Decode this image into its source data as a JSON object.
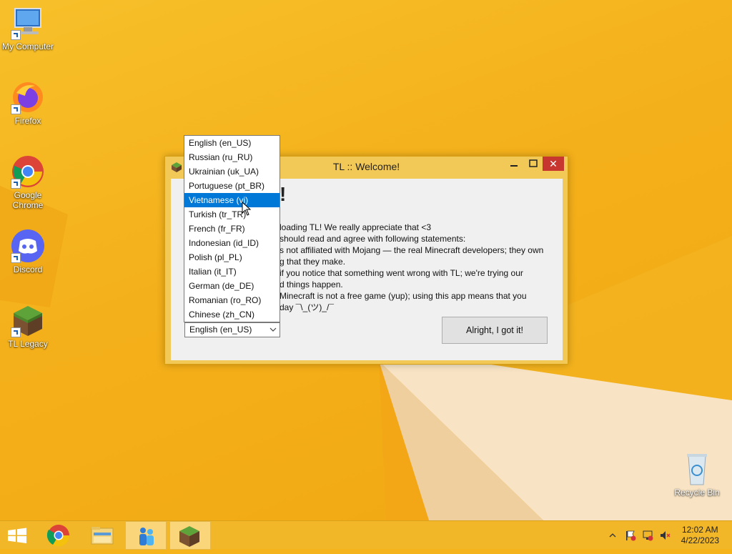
{
  "desktop": {
    "icons": [
      {
        "label": "My Computer",
        "icon": "computer-icon"
      },
      {
        "label": "Firefox",
        "icon": "firefox-icon"
      },
      {
        "label": "Google Chrome",
        "icon": "chrome-icon"
      },
      {
        "label": "Discord",
        "icon": "discord-icon"
      },
      {
        "label": "TL Legacy",
        "icon": "minecraft-grass-block-icon"
      },
      {
        "label": "Recycle Bin",
        "icon": "recycle-bin-icon"
      }
    ]
  },
  "window": {
    "title": "TL :: Welcome!",
    "close_glyph": "✕",
    "heading_fragment": "!",
    "lines": [
      "loading TL! We really appreciate that <3",
      "should read and agree with following statements:",
      "s not affiliated with Mojang — the real Minecraft developers; they own",
      "g that they make.",
      " if you notice that something went wrong with TL; we're trying our",
      "d things happen.",
      "Minecraft is not a free game (yup); using this app means that you",
      "day ¯\\_(ツ)_/¯"
    ],
    "got_it_label": "Alright, I got it!",
    "language_selected": "English (en_US)"
  },
  "dropdown": {
    "items": [
      "English (en_US)",
      "Russian (ru_RU)",
      "Ukrainian (uk_UA)",
      "Portuguese (pt_BR)",
      "Vietnamese (vi)",
      "Turkish (tr_TR)",
      "French (fr_FR)",
      "Indonesian (id_ID)",
      "Polish (pl_PL)",
      "Italian (it_IT)",
      "German (de_DE)",
      "Romanian (ro_RO)",
      "Chinese (zh_CN)"
    ],
    "highlighted": "Vietnamese (vi)"
  },
  "taskbar": {
    "items": [
      "start-icon",
      "chrome-icon",
      "file-explorer-icon",
      "tl-people-icon",
      "minecraft-grass-block-icon"
    ],
    "time": "12:02 AM",
    "date": "4/22/2023"
  },
  "colors": {
    "accent": "#0078d7",
    "close": "#c7372f",
    "desktop": "#f5b41c"
  }
}
